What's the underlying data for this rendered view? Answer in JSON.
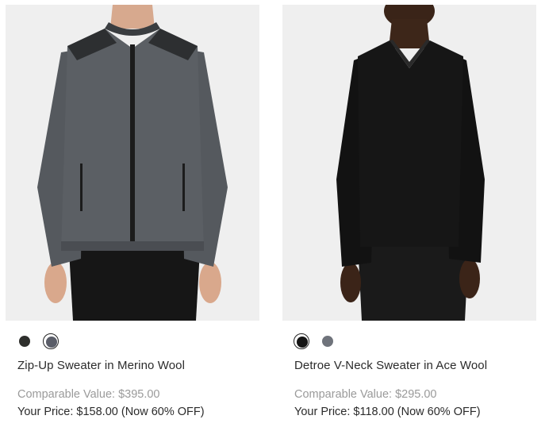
{
  "products": [
    {
      "name": "Zip-Up Sweater in Merino Wool",
      "comparable": "Comparable Value: $395.00",
      "price": "Your Price: $158.00 (Now 60% OFF)",
      "swatches": [
        {
          "color": "#2e2f2c",
          "selected": false
        },
        {
          "color": "#5a5d68",
          "selected": true
        }
      ]
    },
    {
      "name": "Detroe V-Neck Sweater in Ace Wool",
      "comparable": "Comparable Value: $295.00",
      "price": "Your Price: $118.00 (Now 60% OFF)",
      "swatches": [
        {
          "color": "#141414",
          "selected": true
        },
        {
          "color": "#6f737b",
          "selected": false
        }
      ]
    }
  ]
}
